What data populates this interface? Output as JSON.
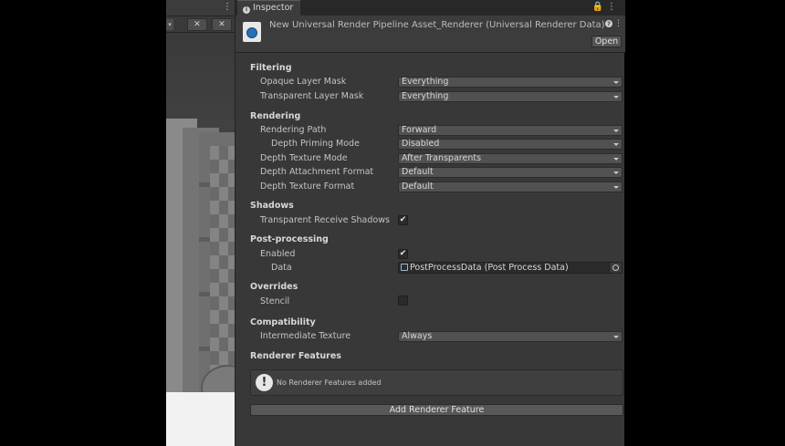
{
  "scene": {
    "toolbar_more": "⋮",
    "buttons": [
      "✕",
      "✕"
    ]
  },
  "inspector": {
    "tab_label": "Inspector",
    "tab_icon": "info-icon",
    "tab_actions": "🔒⋮",
    "asset_title": "New Universal Render Pipeline Asset_Renderer (Universal Renderer Data)",
    "open_label": "Open"
  },
  "filtering": {
    "title": "Filtering",
    "opaque_label": "Opaque Layer Mask",
    "opaque_value": "Everything",
    "transparent_label": "Transparent Layer Mask",
    "transparent_value": "Everything"
  },
  "rendering": {
    "title": "Rendering",
    "path_label": "Rendering Path",
    "path_value": "Forward",
    "depth_priming_label": "Depth Priming Mode",
    "depth_priming_value": "Disabled",
    "depth_texture_mode_label": "Depth Texture Mode",
    "depth_texture_mode_value": "After Transparents",
    "depth_attachment_label": "Depth Attachment Format",
    "depth_attachment_value": "Default",
    "depth_texture_format_label": "Depth Texture Format",
    "depth_texture_format_value": "Default"
  },
  "shadows": {
    "title": "Shadows",
    "transparent_receive_label": "Transparent Receive Shadows",
    "transparent_receive_checked": "✔"
  },
  "post_processing": {
    "title": "Post-processing",
    "enabled_label": "Enabled",
    "enabled_checked": "✔",
    "data_label": "Data",
    "data_value": "PostProcessData (Post Process Data)"
  },
  "overrides": {
    "title": "Overrides",
    "stencil_label": "Stencil"
  },
  "compatibility": {
    "title": "Compatibility",
    "intermediate_label": "Intermediate Texture",
    "intermediate_value": "Always"
  },
  "renderer_features": {
    "title": "Renderer Features",
    "empty_message": "No Renderer Features added",
    "add_label": "Add Renderer Feature"
  }
}
